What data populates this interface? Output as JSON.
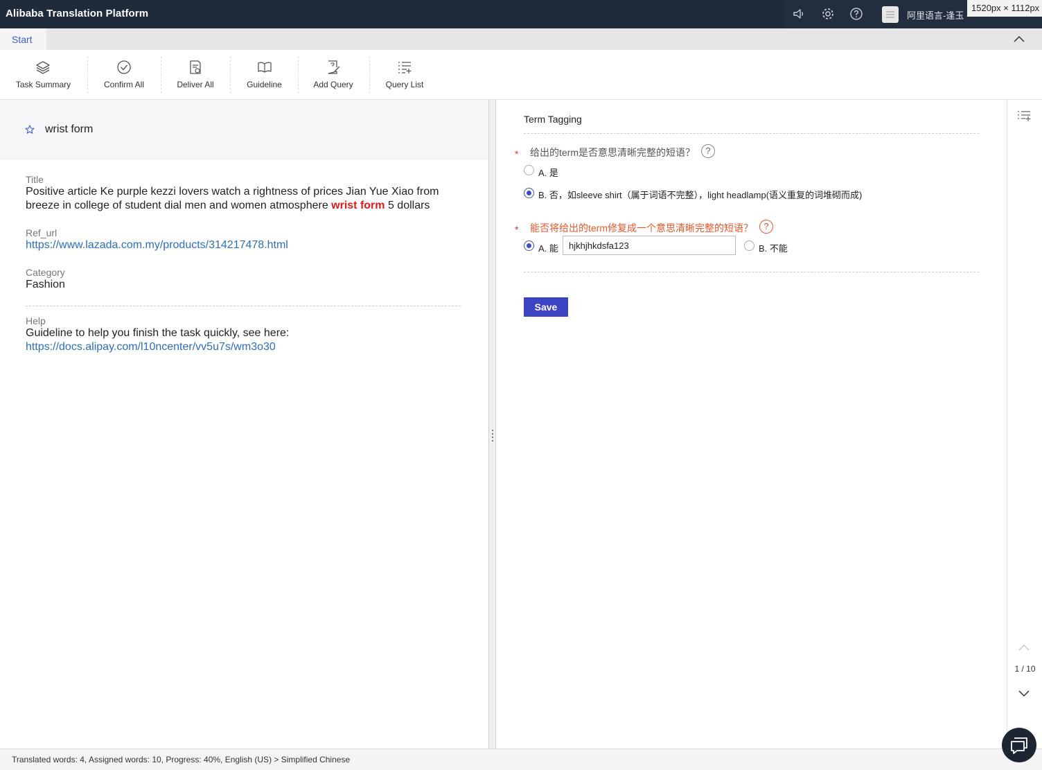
{
  "app": {
    "title": "Alibaba Translation Platform",
    "user_name": "阿里语言-逢玉 -",
    "dimension_overlay": "1520px × 1112px"
  },
  "header_icons": [
    "speaker-icon",
    "gear-icon",
    "help-icon",
    "user-avatar"
  ],
  "tabs": {
    "start": "Start"
  },
  "toolbar": {
    "task_summary": "Task Summary",
    "confirm_all": "Confirm All",
    "deliver_all": "Deliver All",
    "guideline": "Guideline",
    "add_query": "Add Query",
    "query_list": "Query List"
  },
  "term": {
    "text": "wrist form"
  },
  "fields": {
    "title_label": "Title",
    "title_before": "Positive article Ke purple kezzi lovers watch a rightness of prices Jian Yue Xiao from breeze in college of student dial men and women atmosphere ",
    "title_highlight": "wrist form",
    "title_after": " 5 dollars",
    "ref_label": "Ref_url",
    "ref_url": "https://www.lazada.com.my/products/314217478.html",
    "category_label": "Category",
    "category_value": "Fashion",
    "help_label": "Help",
    "help_text": "Guideline to help you finish the task quickly, see here:",
    "help_url": "https://docs.alipay.com/l10ncenter/vv5u7s/wm3o30"
  },
  "tagging": {
    "title": "Term Tagging",
    "required_mark": "*",
    "q1": {
      "text": "给出的term是否意思清晰完整的短语？",
      "help": "?",
      "option_a": "A. 是",
      "option_b": "B. 否，如sleeve shirt（属于词语不完整），light headlamp(语义重复的词堆砌而成)",
      "selected": "B"
    },
    "q2": {
      "text": "能否将给出的term修复成一个意思清晰完整的短语？",
      "help": "?",
      "option_a": "A. 能",
      "input_value": "hjkhjhkdsfa123",
      "option_b": "B. 不能",
      "selected": "A"
    },
    "save_label": "Save"
  },
  "pager": {
    "indicator": "1 / 10"
  },
  "status": {
    "text": "Translated words: 4, Assigned words: 10, Progress: 40%, English (US) > Simplified Chinese"
  },
  "colors": {
    "topbar": "#1f2a3a",
    "accent": "#3c44c4",
    "link": "#2b6fbd",
    "highlight": "#e01a1a",
    "question_orange": "#e8572a"
  }
}
